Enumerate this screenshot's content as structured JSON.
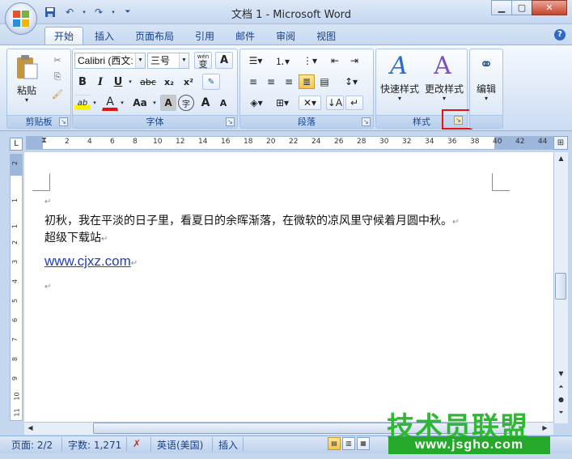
{
  "window": {
    "title": "文档 1 - Microsoft Word",
    "controls": {
      "minimize": "▁",
      "maximize": "▢",
      "close": "✕"
    }
  },
  "quick_access": {
    "save_icon": "save-icon",
    "undo_icon": "undo-icon",
    "redo_icon": "redo-icon",
    "customize_icon": "chevron-down-icon"
  },
  "tabs": [
    {
      "label": "开始",
      "active": true
    },
    {
      "label": "插入"
    },
    {
      "label": "页面布局"
    },
    {
      "label": "引用"
    },
    {
      "label": "邮件"
    },
    {
      "label": "审阅"
    },
    {
      "label": "视图"
    }
  ],
  "ribbon": {
    "clipboard": {
      "group_label": "剪贴板",
      "paste_label": "粘贴"
    },
    "font": {
      "group_label": "字体",
      "font_name": "Calibri (西文:",
      "font_size": "三号",
      "wen_label": "wén",
      "wen_char": "变",
      "bold": "B",
      "italic": "I",
      "underline": "U",
      "strike": "abc",
      "subscript": "x₂",
      "superscript": "x²",
      "change_case": "Aa",
      "grow": "A",
      "shrink": "A",
      "char_border": "A",
      "enclose": "字",
      "shade": "A",
      "highlight": "ab",
      "color": "A"
    },
    "paragraph": {
      "group_label": "段落"
    },
    "styles": {
      "group_label": "样式",
      "quick_styles_label": "快速样式",
      "change_styles_label": "更改样式"
    },
    "editing": {
      "group_label": "",
      "edit_label": "编辑"
    }
  },
  "ruler": {
    "numbers": [
      "2",
      "2",
      "4",
      "6",
      "8",
      "10",
      "12",
      "14",
      "16",
      "18",
      "20",
      "22",
      "24",
      "26",
      "28",
      "30",
      "32",
      "34",
      "36",
      "38",
      "40",
      "42",
      "44"
    ],
    "vertical_numbers": [
      "2",
      "1",
      "1",
      "2",
      "3",
      "4",
      "5",
      "6",
      "7",
      "8",
      "9",
      "10",
      "11",
      "12"
    ]
  },
  "document": {
    "line1": "初秋，我在平淡的日子里，看夏日的余晖渐落，在微软的凉风里守候着月圆中秋。",
    "line2": "超级下载站",
    "link": "www.cjxz.com",
    "paragraph_mark": "↵"
  },
  "statusbar": {
    "page": "页面: 2/2",
    "words": "字数: 1,271",
    "language": "英语(美国)",
    "mode": "插入"
  },
  "watermark": {
    "top": "技术员联盟",
    "bottom": "www.jsgho.com"
  },
  "colors": {
    "accent": "#15428b",
    "highlight_box": "#e31313",
    "link": "#1f3fb8"
  }
}
